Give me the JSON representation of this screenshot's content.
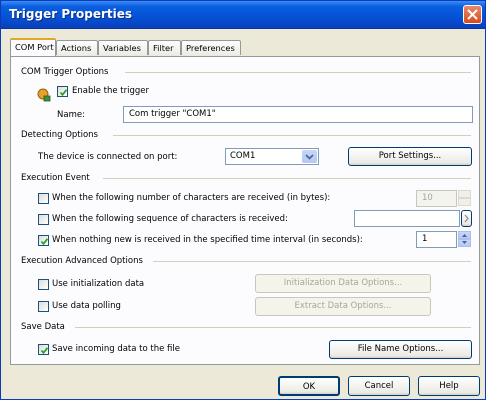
{
  "window": {
    "title": "Trigger Properties"
  },
  "tabs": [
    "COM Port",
    "Actions",
    "Variables",
    "Filter",
    "Preferences"
  ],
  "com_trigger": {
    "section": "COM Trigger Options",
    "enable_label": "Enable the trigger",
    "enable_checked": true,
    "name_label": "Name:",
    "name_value": "Com trigger \"COM1\""
  },
  "detecting": {
    "section": "Detecting Options",
    "port_label": "The device is connected on port:",
    "port_value": "COM1",
    "port_settings_button": "Port Settings..."
  },
  "execution": {
    "section": "Execution Event",
    "chars_label": "When the following number of characters are received (in bytes):",
    "chars_checked": false,
    "chars_value": "10",
    "sequence_label": "When the following sequence of characters is received:",
    "sequence_checked": false,
    "sequence_value": "",
    "interval_label": "When nothing new is received in the specified time interval (in seconds):",
    "interval_checked": true,
    "interval_value": "1"
  },
  "advanced": {
    "section": "Execution Advanced Options",
    "init_label": "Use initialization data",
    "init_checked": false,
    "init_button": "Initialization Data Options...",
    "polling_label": "Use data polling",
    "polling_checked": false,
    "polling_button": "Extract Data Options..."
  },
  "save": {
    "section": "Save Data",
    "save_label": "Save incoming data to the file",
    "save_checked": true,
    "file_button": "File Name Options..."
  },
  "footer": {
    "ok": "OK",
    "cancel": "Cancel",
    "help": "Help"
  },
  "colors": {
    "titlebar": "#0553d6",
    "dialog": "#ece9d8",
    "panel": "#fcfcfe",
    "close": "#d94a1a"
  }
}
